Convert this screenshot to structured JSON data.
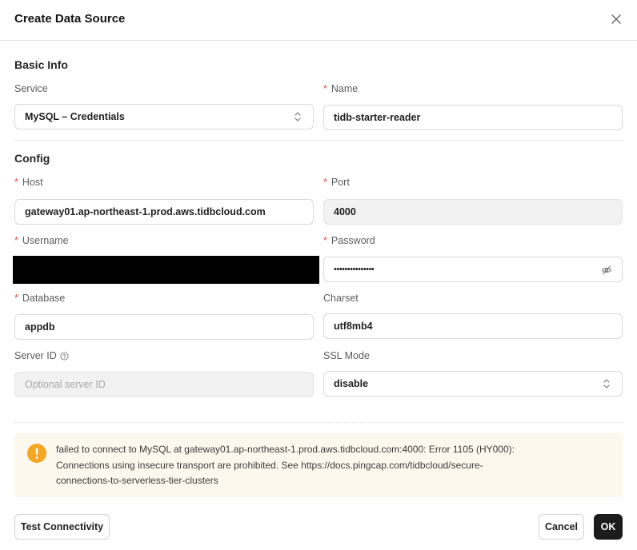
{
  "dialog": {
    "title": "Create Data Source"
  },
  "sections": {
    "basic_info": "Basic Info",
    "config": "Config"
  },
  "fields": {
    "service": {
      "label": "Service",
      "value": "MySQL – Credentials"
    },
    "name": {
      "label": "Name",
      "value": "tidb-starter-reader"
    },
    "host": {
      "label": "Host",
      "value": "gateway01.ap-northeast-1.prod.aws.tidbcloud.com"
    },
    "port": {
      "label": "Port",
      "value": "4000"
    },
    "username": {
      "label": "Username",
      "value": "[redacted]"
    },
    "password": {
      "label": "Password",
      "value": "•••••••••••••••"
    },
    "database": {
      "label": "Database",
      "value": "appdb"
    },
    "charset": {
      "label": "Charset",
      "value": "utf8mb4"
    },
    "server_id": {
      "label": "Server ID",
      "placeholder": "Optional server ID"
    },
    "ssl_mode": {
      "label": "SSL Mode",
      "value": "disable"
    }
  },
  "required_marker": "*",
  "alert": {
    "icon": "warning-icon",
    "color": "#f5a623",
    "line1": "failed to connect to MySQL at gateway01.ap-northeast-1.prod.aws.tidbcloud.com:4000: Error 1105 (HY000):",
    "line2": "Connections using insecure transport are prohibited. See https://docs.pingcap.com/tidbcloud/secure-",
    "line3": "connections-to-serverless-tier-clusters"
  },
  "buttons": {
    "test": "Test Connectivity",
    "cancel": "Cancel",
    "ok": "OK"
  }
}
